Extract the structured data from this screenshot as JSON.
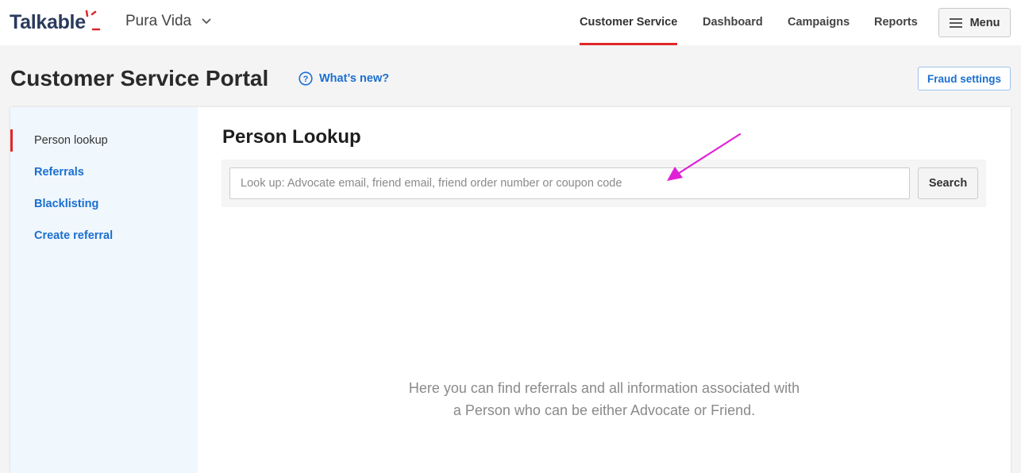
{
  "header": {
    "logo_text": "Talkable",
    "brand": "Pura Vida",
    "nav": [
      "Customer Service",
      "Dashboard",
      "Campaigns",
      "Reports"
    ],
    "menu_label": "Menu",
    "accent_color": "#e0282a",
    "link_color": "#1a6fd0"
  },
  "page": {
    "title": "Customer Service Portal",
    "whats_new": "What’s new?",
    "fraud_settings": "Fraud settings"
  },
  "sidebar": {
    "items": [
      "Person lookup",
      "Referrals",
      "Blacklisting",
      "Create referral"
    ],
    "active": "Person lookup"
  },
  "main": {
    "title": "Person Lookup",
    "search_placeholder": "Look up: Advocate email, friend email, friend order number or coupon code",
    "search_value": "",
    "search_button": "Search",
    "empty_line1": "Here you can find referrals and all information associated with",
    "empty_line2": "a Person who can be either Advocate or Friend."
  }
}
